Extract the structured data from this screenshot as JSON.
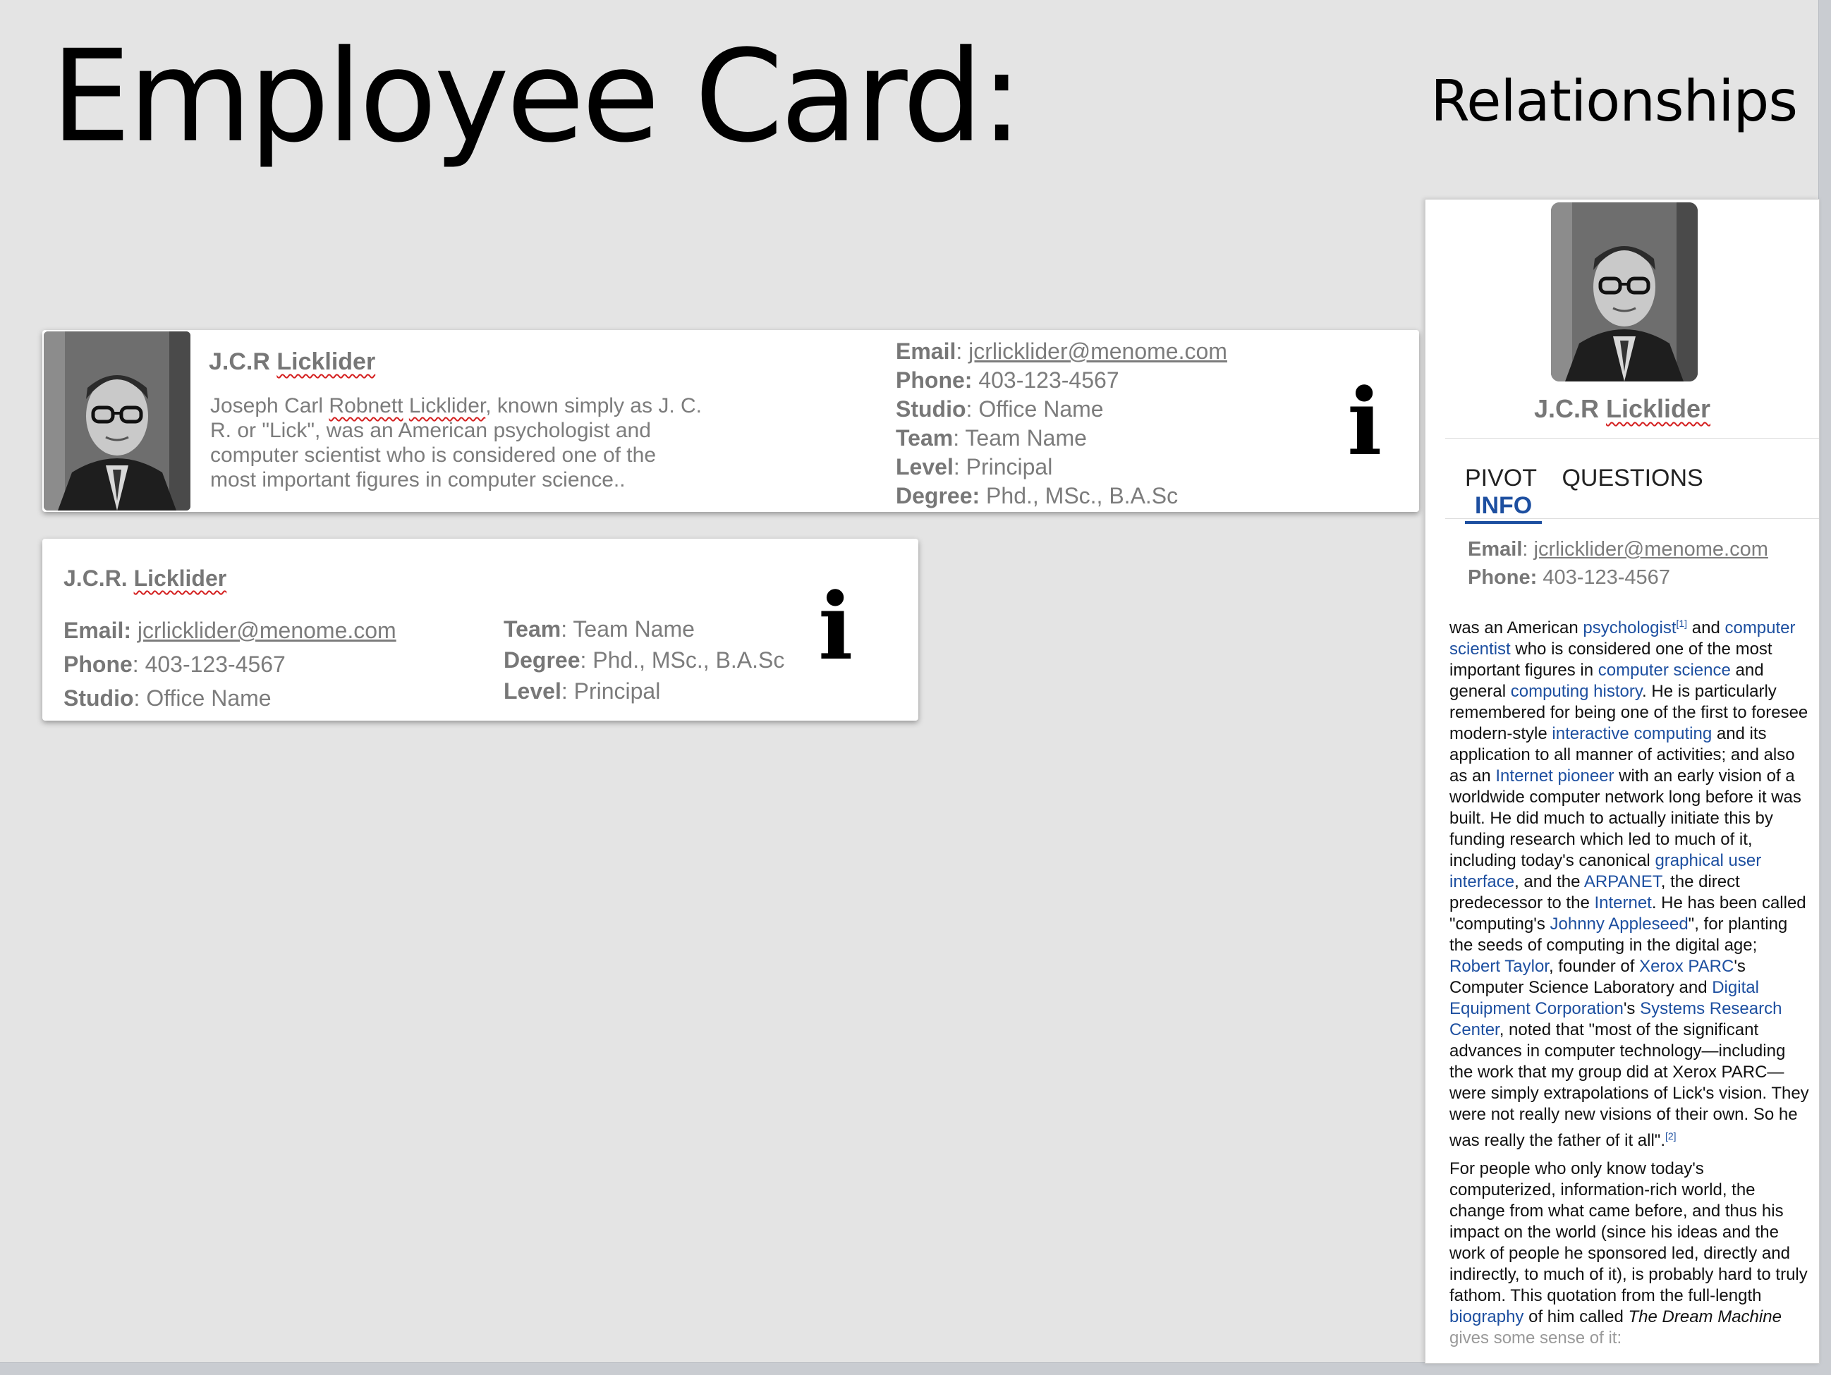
{
  "slide": {
    "title": "Employee Card:",
    "subtitle": "Relationships"
  },
  "card_full": {
    "name_first": "J.C.R ",
    "name_last": "Licklider",
    "bio_1": "Joseph Carl ",
    "bio_robnett": "Robnett",
    "bio_2": " ",
    "bio_licklider": "Licklider",
    "bio_3": ", known simply as J. C. R. or \"Lick\", was an American psychologist and computer scientist who is considered one of the most important figures in computer science..",
    "email_label": "Email",
    "email": "jcrlicklider@menome.com",
    "phone_label": "Phone:",
    "phone": "403-123-4567",
    "studio_label": "Studio",
    "studio": "Office Name",
    "team_label": "Team",
    "team": "Team Name",
    "level_label": "Level",
    "level": "Principal",
    "degree_label": "Degree:",
    "degree": "Phd., MSc., B.A.Sc",
    "info_glyph": "i"
  },
  "card_compact": {
    "name_first": "J.C.R. ",
    "name_last": "Licklider",
    "email_label": "Email:",
    "email": "jcrlicklider@menome.com",
    "phone_label": "Phone",
    "phone": "403-123-4567",
    "studio_label": "Studio",
    "studio": "Office Name",
    "team_label": "Team",
    "team": "Team Name",
    "degree_label": "Degree",
    "degree": "Phd., MSc., B.A.Sc",
    "level_label": "Level",
    "level": "Principal",
    "info_glyph": "i"
  },
  "panel": {
    "name_first": "J.C.R ",
    "name_last": "Licklider",
    "tabs": [
      "PIVOT",
      "QUESTIONS",
      "INFO"
    ],
    "active_tab": "INFO",
    "email_label": "Email",
    "email": "jcrlicklider@menome.com",
    "phone_label": "Phone:",
    "phone": "403-123-4567",
    "article": {
      "t1": "was an American ",
      "l1": "psychologist",
      "s1": "[1]",
      "t2": " and ",
      "l2": "computer scientist",
      "t3": " who is considered one of the most important figures in ",
      "l3": "computer science",
      "t4": " and general ",
      "l4": "computing history",
      "t5": ". He is particularly remembered for being one of the first to foresee modern-style ",
      "l5": "interactive computing",
      "t6": " and its application to all manner of activities; and also as an ",
      "l6": "Internet pioneer",
      "t7": " with an early vision of a worldwide computer network long before it was built. He did much to actually initiate this by funding research which led to much of it, including today's canonical ",
      "l7": "graphical user interface",
      "t8": ", and the ",
      "l8": "ARPANET",
      "t9": ", the direct predecessor to the ",
      "l9": "Internet",
      "t10": ". He has been called \"computing's ",
      "l10": "Johnny Appleseed",
      "t11": "\", for planting the seeds of computing in the digital age; ",
      "l11": "Robert Taylor",
      "t12": ", founder of ",
      "l12": "Xerox PARC",
      "t13": "'s Computer Science Laboratory and ",
      "l13": "Digital Equipment Corporation",
      "t14": "'s ",
      "l14": "Systems Research Center",
      "t15": ", noted that \"most of the significant advances in computer technology—including the work that my group did at Xerox PARC—were simply extrapolations of Lick's vision. They were not really new visions of their own. So he was really the father of it all\".",
      "s2": "[2]",
      "p2_t1": "For people who only know today's computerized, information-rich world, the change from what came before, and thus his impact on the world (since his ideas and the work of people he sponsored led, directly and indirectly, to much of it), is probably hard to truly fathom. This quotation from the full-length ",
      "p2_l1": "biography",
      "p2_t2": " of him called ",
      "p2_i1": "The Dream Machine",
      "p2_t3": " gives some sense of it:"
    }
  },
  "colors": {
    "background": "#e4e4e4",
    "card": "#ffffff",
    "link": "#1d4fa0",
    "muted_text": "#7c7c7c"
  },
  "icons": {
    "info": "info-icon",
    "photo": "portrait-photo"
  }
}
